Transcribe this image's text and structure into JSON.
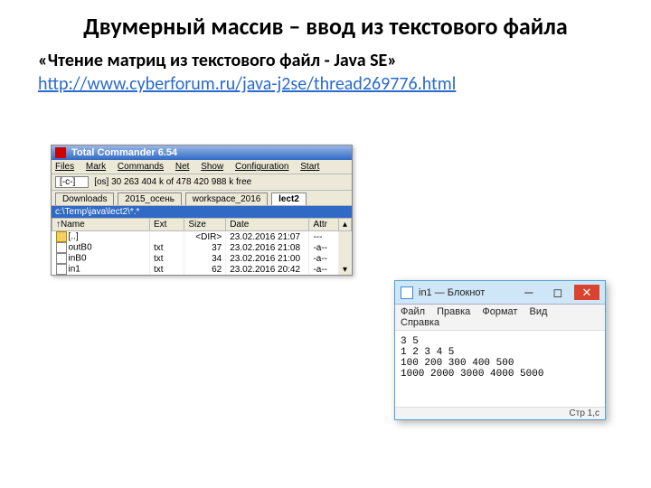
{
  "heading": "Двумерный массив – ввод из текстового файла",
  "subheading": "«Чтение матриц из текстового файл - Java SE»",
  "url": "http://www.cyberforum.ru/java-j2se/thread269776.html",
  "tc": {
    "title": "Total Commander 6.54",
    "menu": [
      "Files",
      "Mark",
      "Commands",
      "Net",
      "Show",
      "Configuration",
      "Start"
    ],
    "drive_label": "[-c-]",
    "drive_info": "[os]  30 263 404 k of 478 420 988 k free",
    "tabs": [
      "Downloads",
      "2015_осень",
      "workspace_2016",
      "lect2"
    ],
    "active_tab": 3,
    "path": "c:\\Temp\\java\\lect2\\*.*",
    "columns": [
      "Name",
      "Ext",
      "Size",
      "Date",
      "Attr"
    ],
    "rows": [
      {
        "icon": "dir",
        "name": "[..]",
        "ext": "",
        "size": "<DIR>",
        "date": "23.02.2016 21:07",
        "attr": "---"
      },
      {
        "icon": "file",
        "name": "outB0",
        "ext": "txt",
        "size": "37",
        "date": "23.02.2016 21:08",
        "attr": "-a--"
      },
      {
        "icon": "file",
        "name": "inB0",
        "ext": "txt",
        "size": "34",
        "date": "23.02.2016 21:00",
        "attr": "-a--"
      },
      {
        "icon": "file",
        "name": "in1",
        "ext": "txt",
        "size": "62",
        "date": "23.02.2016 20:42",
        "attr": "-a--"
      }
    ]
  },
  "np": {
    "title": "in1 — Блокнот",
    "menu": [
      "Файл",
      "Правка",
      "Формат",
      "Вид",
      "Справка"
    ],
    "content": "3 5\n1 2 3 4 5\n100 200 300 400 500\n1000 2000 3000 4000 5000",
    "status": "Стр 1,с"
  }
}
